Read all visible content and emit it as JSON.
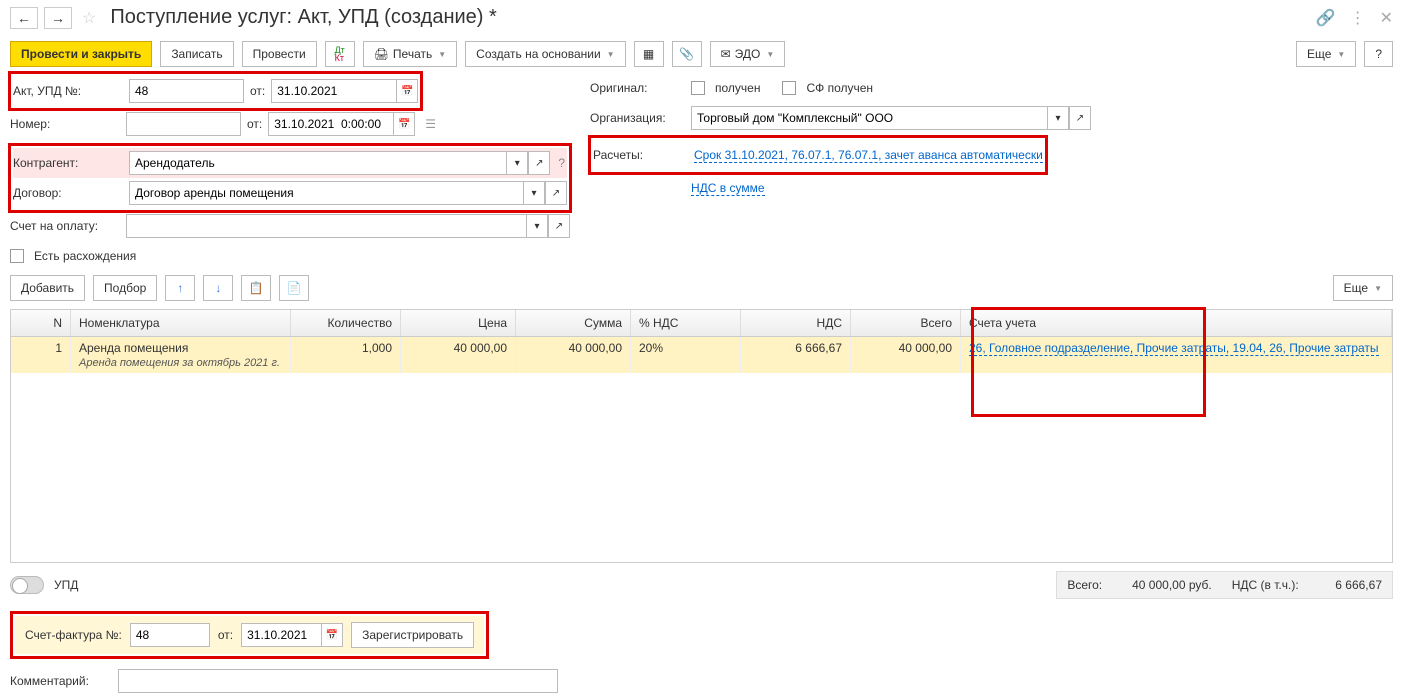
{
  "title": "Поступление услуг: Акт, УПД (создание) *",
  "toolbar": {
    "post_close": "Провести и закрыть",
    "write": "Записать",
    "post": "Провести",
    "print": "Печать",
    "create_based": "Создать на основании",
    "edo": "ЭДО",
    "more": "Еще",
    "help": "?"
  },
  "form": {
    "act_label": "Акт, УПД №:",
    "act_no": "48",
    "from_label": "от:",
    "act_date": "31.10.2021",
    "number_label": "Номер:",
    "number_date": "31.10.2021  0:00:00",
    "counterparty_label": "Контрагент:",
    "counterparty": "Арендодатель",
    "contract_label": "Договор:",
    "contract": "Договор аренды помещения",
    "invoice_label": "Счет на оплату:",
    "discrepancy_label": "Есть расхождения",
    "original_label": "Оригинал:",
    "received": "получен",
    "sf_received": "СФ получен",
    "org_label": "Организация:",
    "org": "Торговый дом \"Комплексный\" ООО",
    "calc_label": "Расчеты:",
    "calc_link": "Срок 31.10.2021, 76.07.1, 76.07.1, зачет аванса автоматически",
    "vat_link": "НДС в сумме"
  },
  "table_toolbar": {
    "add": "Добавить",
    "select": "Подбор",
    "more": "Еще"
  },
  "grid": {
    "headers": {
      "n": "N",
      "nom": "Номенклатура",
      "qty": "Количество",
      "price": "Цена",
      "sum": "Сумма",
      "vat": "% НДС",
      "nds": "НДС",
      "total": "Всего",
      "acct": "Счета учета"
    },
    "row": {
      "n": "1",
      "nom": "Аренда помещения",
      "nom_sub": "Аренда помещения за октябрь 2021 г.",
      "qty": "1,000",
      "price": "40 000,00",
      "sum": "40 000,00",
      "vat": "20%",
      "nds": "6 666,67",
      "total": "40 000,00",
      "acct": "26, Головное подразделение, Прочие затраты, 19.04, 26, Прочие затраты"
    }
  },
  "totals": {
    "upd_label": "УПД",
    "total_label": "Всего:",
    "total": "40 000,00",
    "rub": "руб.",
    "vat_label": "НДС (в т.ч.):",
    "vat": "6 666,67"
  },
  "sf": {
    "label": "Счет-фактура №:",
    "no": "48",
    "from": "от:",
    "date": "31.10.2021",
    "register": "Зарегистрировать"
  },
  "comment_label": "Комментарий:"
}
